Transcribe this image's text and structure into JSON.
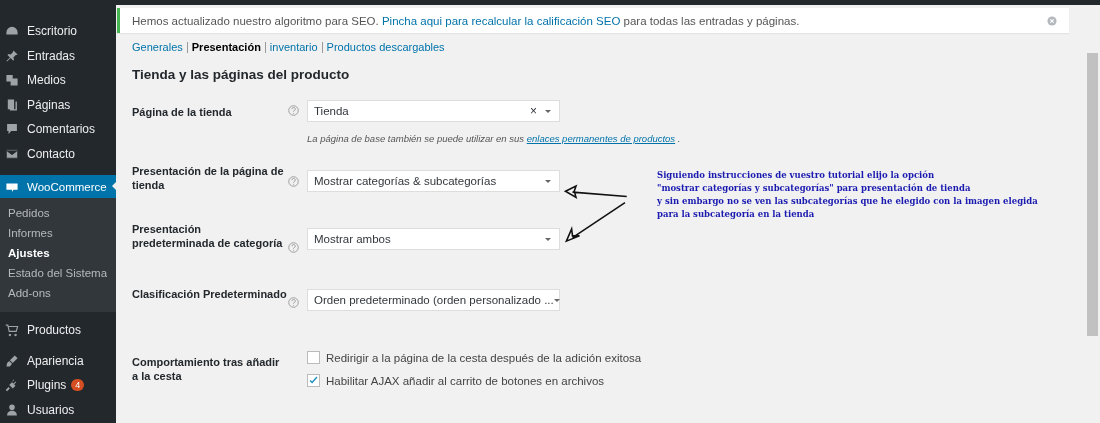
{
  "sidebar": {
    "items": [
      {
        "label": "Escritorio",
        "selected": false
      },
      {
        "label": "Entradas",
        "selected": false
      },
      {
        "label": "Medios",
        "selected": false
      },
      {
        "label": "Páginas",
        "selected": false
      },
      {
        "label": "Comentarios",
        "selected": false
      },
      {
        "label": "Contacto",
        "selected": false
      },
      {
        "label": "WooCommerce",
        "selected": true,
        "children": [
          {
            "label": "Pedidos",
            "selected": false
          },
          {
            "label": "Informes",
            "selected": false
          },
          {
            "label": "Ajustes",
            "selected": true
          },
          {
            "label": "Estado del Sistema",
            "selected": false
          },
          {
            "label": "Add-ons",
            "selected": false
          }
        ]
      },
      {
        "label": "Productos",
        "selected": false
      },
      {
        "label": "Apariencia",
        "selected": false
      },
      {
        "label": "Plugins",
        "selected": false,
        "badge": "4"
      },
      {
        "label": "Usuarios",
        "selected": false
      }
    ]
  },
  "notice": {
    "text_before": "Hemos actualizado nuestro algoritmo para SEO.",
    "link": "Pincha aqui para recalcular la calificación SEO",
    "text_after": "para todas las entradas y páginas."
  },
  "tabs": [
    {
      "label": "Generales",
      "selected": false
    },
    {
      "label": "Presentación",
      "selected": true
    },
    {
      "label": "inventario",
      "selected": false
    },
    {
      "label": "Productos descargables",
      "selected": false
    }
  ],
  "section_title": "Tienda y las páginas del producto",
  "settings": [
    {
      "kind": "select",
      "label": "Página de la tienda",
      "value": "Tienda",
      "clear": "×",
      "description": {
        "text": "La página de base también se puede utilizar en sus",
        "link": "enlaces permanentes de productos",
        "after": "."
      }
    },
    {
      "kind": "select",
      "label": "Presentación de la página de tienda",
      "value": "Mostrar categorías & subcategorías"
    },
    {
      "kind": "select",
      "label": "Presentación predeterminada de categoría",
      "value": "Mostrar ambos"
    },
    {
      "kind": "select",
      "label": "Clasificación Predeterminado",
      "value": "Orden predeterminado (orden personalizado ..."
    },
    {
      "kind": "checkboxes",
      "label": "Comportamiento tras añadir a la cesta",
      "options": [
        {
          "label": "Redirigir a la página de la cesta después de la adición exitosa",
          "checked": false
        },
        {
          "label": "Habilitar AJAX añadir al carrito de botones en archivos",
          "checked": true
        }
      ]
    }
  ],
  "annotation": {
    "lines": [
      "Siguiendo instrucciones de vuestro tutorial elijo la opción",
      "\"mostrar categorías y subcategorías\" para presentación de tienda",
      "y sin embargo no se ven las subcategorías que he elegido con la imagen elegida",
      "para la subcategoría en la tienda"
    ]
  }
}
